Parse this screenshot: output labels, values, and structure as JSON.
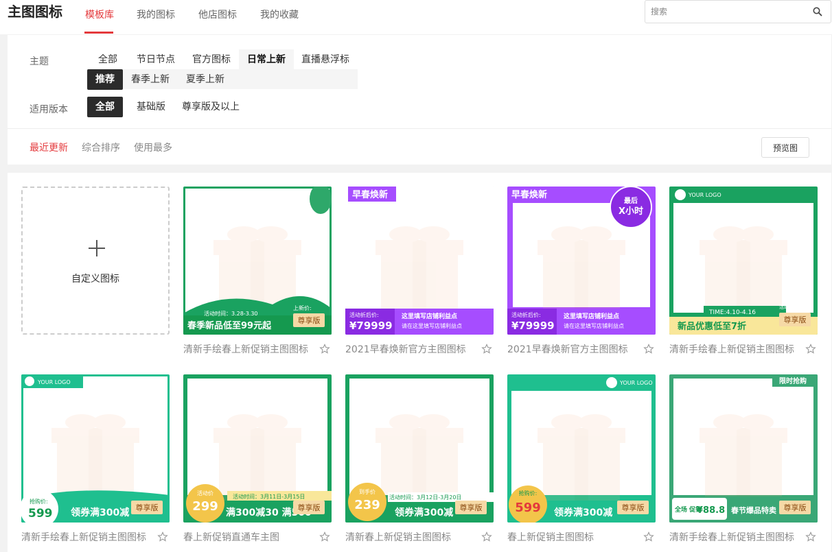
{
  "header": {
    "title": "主图图标",
    "tabs": [
      "模板库",
      "我的图标",
      "他店图标",
      "我的收藏"
    ],
    "search_placeholder": "搜索"
  },
  "filters": {
    "theme_label": "主题",
    "theme_options": [
      "全部",
      "节日节点",
      "官方图标",
      "日常上新",
      "直播悬浮标"
    ],
    "theme_sub_options": [
      "推荐",
      "春季上新",
      "夏季上新"
    ],
    "version_label": "适用版本",
    "version_options": [
      "全部",
      "基础版",
      "尊享版及以上"
    ]
  },
  "sort": {
    "options": [
      "最近更新",
      "综合排序",
      "使用最多"
    ],
    "preview_label": "预览图"
  },
  "custom_icon_label": "自定义图标",
  "cards": [
    {
      "caption": "清新手绘春上新促销主图图标",
      "banner": "春季新品低至99元起",
      "badge": "尊享版",
      "tag": "活动时间：3.28-3.30",
      "side": "上新价:"
    },
    {
      "caption": "2021早春焕新官方主图图标",
      "corner": "早春焕新",
      "price_label": "活动折后价:",
      "price": "¥79999",
      "line1": "这里填写店铺利益点",
      "line2": "请在这里填写店铺利益点"
    },
    {
      "caption": "2021早春焕新官方主图图标",
      "corner": "早春焕新",
      "bubble1": "最后",
      "bubble2": "X小时",
      "price_label": "活动折后价:",
      "price": "¥79999",
      "line1": "这里填写店铺利益点",
      "line2": "请在这里填写店铺利益点"
    },
    {
      "caption": "清新手绘春上新促销主图图标",
      "logo": "YOUR LOGO",
      "banner": "新品优惠低至7折",
      "badge": "尊享版",
      "tag": "TIME:4.10-4.16",
      "side": "活动到手价"
    },
    {
      "caption": "清新手绘春上新促销主图图标",
      "logo": "YOUR LOGO",
      "price_label": "抢购价:",
      "price": "599",
      "banner": "领券满300减",
      "badge": "尊享版"
    },
    {
      "caption": "春上新促销直通车主图",
      "price_label": "活动价",
      "price": "299",
      "tag": "活动时间：3月11日-3月15日",
      "banner": "满300减30 满500",
      "badge": "尊享版"
    },
    {
      "caption": "清新春上新促销主图图标",
      "price_label": "到手价",
      "price": "239",
      "tag": "活动时间：3月12日-3月20日",
      "banner": "领券满300减",
      "badge": "尊享版"
    },
    {
      "caption": "春上新促销主图图标",
      "logo": "YOUR LOGO",
      "price_label": "抢购价:",
      "price": "599",
      "banner": "领券满300减",
      "badge": "尊享版"
    },
    {
      "caption": "清新手绘春上新促销主图图标",
      "corner": "限时抢购",
      "side": "全场 促销",
      "price": "¥88.8",
      "banner": "春节爆品特卖",
      "badge": "尊享版"
    }
  ],
  "colors": {
    "accent": "#e4393c",
    "green": "#1aa260",
    "purple": "#a64dff",
    "gold": "#f3c54a"
  }
}
